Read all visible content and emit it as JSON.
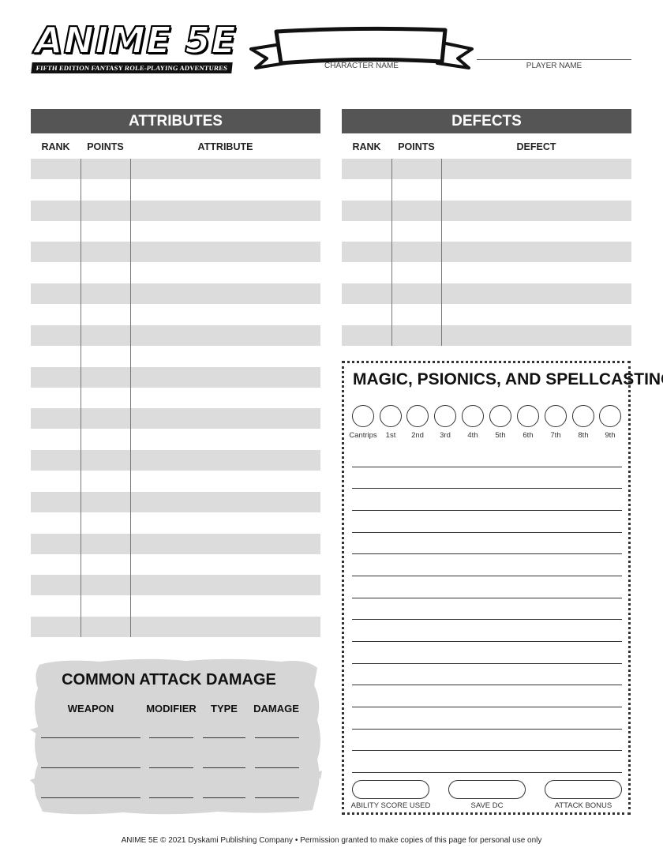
{
  "header": {
    "logo_title": "ANIME 5E",
    "logo_tagline": "FIFTH EDITION FANTASY ROLE-PLAYING ADVENTURES",
    "character_name_label": "CHARACTER NAME",
    "player_name_label": "PLAYER NAME"
  },
  "attributes": {
    "title": "ATTRIBUTES",
    "col_rank": "RANK",
    "col_points": "POINTS",
    "col_attribute": "ATTRIBUTE"
  },
  "defects": {
    "title": "DEFECTS",
    "col_rank": "RANK",
    "col_points": "POINTS",
    "col_defect": "DEFECT"
  },
  "magic": {
    "title": "MAGIC, PSIONICS, AND SPELLCASTING",
    "slots": [
      "Cantrips",
      "1st",
      "2nd",
      "3rd",
      "4th",
      "5th",
      "6th",
      "7th",
      "8th",
      "9th"
    ],
    "ability_score_label": "ABILITY SCORE USED",
    "save_dc_label": "SAVE DC",
    "attack_bonus_label": "ATTACK BONUS"
  },
  "attack_damage": {
    "title": "COMMON ATTACK DAMAGE",
    "col_weapon": "WEAPON",
    "col_modifier": "MODIFIER",
    "col_type": "TYPE",
    "col_damage": "DAMAGE"
  },
  "footer": {
    "text": "ANIME 5E © 2021 Dyskami Publishing Company • Permission granted to make copies of this page for personal use only"
  }
}
